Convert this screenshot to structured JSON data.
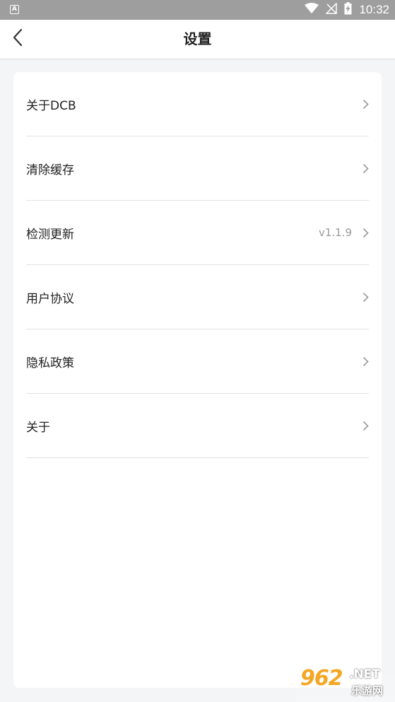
{
  "status_bar": {
    "notification_letter": "A",
    "time": "10:32",
    "icons": [
      "wifi-icon",
      "no-signal-icon",
      "battery-charging-icon"
    ]
  },
  "header": {
    "title": "设置",
    "back_icon": "chevron-left-icon"
  },
  "settings": {
    "items": [
      {
        "label": "关于DCB",
        "value": ""
      },
      {
        "label": "清除缓存",
        "value": ""
      },
      {
        "label": "检测更新",
        "value": "v1.1.9"
      },
      {
        "label": "用户协议",
        "value": ""
      },
      {
        "label": "隐私政策",
        "value": ""
      },
      {
        "label": "关于",
        "value": ""
      }
    ]
  },
  "watermark": {
    "number": "962",
    "domain": ".NET",
    "name": "乐游网"
  },
  "colors": {
    "status_bar": "#9e9e9e",
    "background": "#f4f5f7",
    "card": "#ffffff",
    "divider": "#e3e3e3",
    "value_text": "#9a9a9a",
    "watermark_accent": "#f5a623"
  }
}
